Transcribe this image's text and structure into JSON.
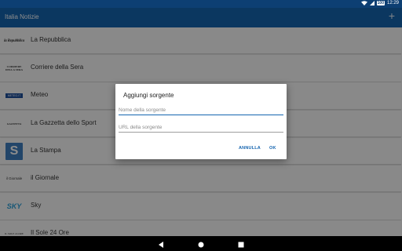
{
  "status_bar": {
    "wifi_icon": "wifi-icon",
    "signal_icon": "signal-icon",
    "battery_percent": "100",
    "time": "12:29"
  },
  "app_bar": {
    "title": "Italia Notizie",
    "add_icon_glyph": "+"
  },
  "sources": [
    {
      "name": "La Repubblica",
      "logo_text": "la Repubblica"
    },
    {
      "name": "Corriere della Sera",
      "logo_text": "CORRIERE DELLA SERA"
    },
    {
      "name": "Meteo",
      "logo_text": "METEO.IT"
    },
    {
      "name": "La Gazzetta dello Sport",
      "logo_text": "GAZZETTA"
    },
    {
      "name": "La Stampa",
      "logo_text": "S"
    },
    {
      "name": "il Giornale",
      "logo_text": "il Giornale"
    },
    {
      "name": "Sky",
      "logo_text": "SKY"
    },
    {
      "name": "Il Sole 24 Ore",
      "logo_text": "IL SOLE 24 ORE"
    }
  ],
  "dialog": {
    "title": "Aggiungi sorgente",
    "name_field": {
      "value": "",
      "placeholder": "Nome della sorgente"
    },
    "url_field": {
      "value": "",
      "placeholder": "URL della sorgente"
    },
    "cancel_label": "ANNULLA",
    "ok_label": "OK"
  },
  "nav_bar": {
    "back_icon": "back-icon",
    "home_icon": "home-icon",
    "recents_icon": "recents-icon"
  },
  "colors": {
    "status_bar": "#0d3f73",
    "app_bar": "#1565b0",
    "accent": "#1565b0"
  }
}
